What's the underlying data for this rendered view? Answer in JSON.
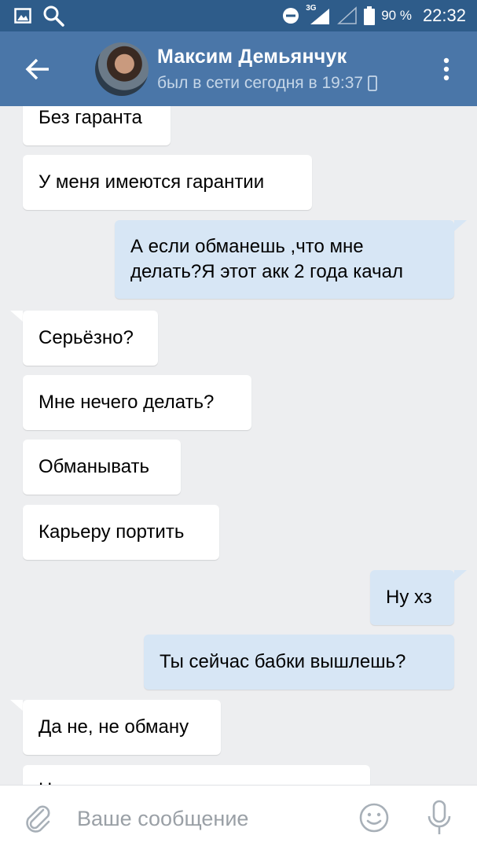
{
  "status_bar": {
    "network": "3G",
    "battery": "90 %",
    "time": "22:32",
    "icons": [
      "gallery-icon",
      "search-icon",
      "do-not-disturb-icon",
      "signal-icon",
      "signal-empty-icon",
      "battery-icon"
    ]
  },
  "header": {
    "name": "Максим Демьянчук",
    "status": "был в сети сегодня в 19:37",
    "icons": [
      "back-arrow-icon",
      "phone-icon",
      "more-vertical-icon"
    ]
  },
  "messages": [
    {
      "side": "in",
      "text": "Без гаранта"
    },
    {
      "side": "in",
      "text": "У меня имеются гарантии"
    },
    {
      "side": "out",
      "text": "А если обманешь ,что мне делать?Я этот акк 2 года качал"
    },
    {
      "side": "in",
      "text": "Серьёзно?"
    },
    {
      "side": "in",
      "text": "Мне нечего делать?"
    },
    {
      "side": "in",
      "text": "Обманывать"
    },
    {
      "side": "in",
      "text": "Карьеру портить"
    },
    {
      "side": "out",
      "text": "Ну хз"
    },
    {
      "side": "out",
      "text": "Ты сейчас бабки вышлешь?"
    },
    {
      "side": "in",
      "text": "Да не, не обману"
    },
    {
      "side": "in",
      "text": "Н"
    }
  ],
  "input": {
    "placeholder": "Ваше сообщение",
    "icons": [
      "attach-icon",
      "emoji-icon",
      "mic-icon"
    ]
  },
  "colors": {
    "status_bar": "#2e5c8a",
    "header": "#4a76a8",
    "background": "#edeef0",
    "incoming": "#ffffff",
    "outgoing": "#d7e6f5"
  }
}
